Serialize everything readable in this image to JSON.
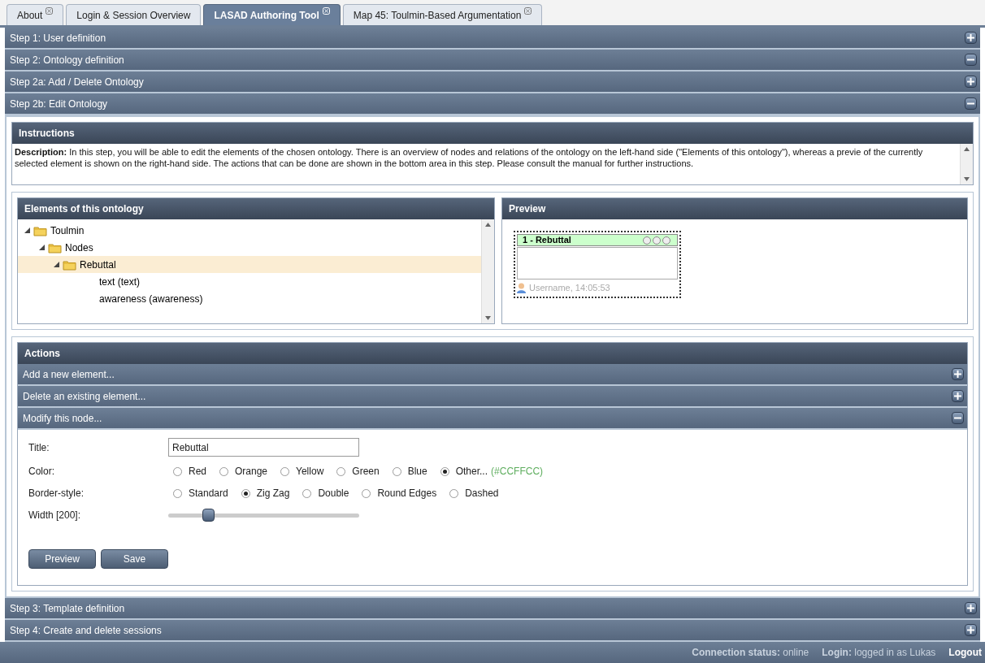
{
  "tabs": [
    {
      "label": "About",
      "selected": false,
      "closable": true
    },
    {
      "label": "Login & Session Overview",
      "selected": false,
      "closable": false
    },
    {
      "label": "LASAD Authoring Tool",
      "selected": true,
      "closable": true
    },
    {
      "label": "Map 45: Toulmin-Based Argumentation",
      "selected": false,
      "closable": true
    }
  ],
  "steps_top": [
    {
      "title": "Step 1: User definition",
      "expanded": false
    },
    {
      "title": "Step 2: Ontology definition",
      "expanded": true
    },
    {
      "title": "Step 2a: Add / Delete Ontology",
      "expanded": false
    },
    {
      "title": "Step 2b: Edit Ontology",
      "expanded": true
    }
  ],
  "instructions": {
    "title": "Instructions",
    "text": "**Description:** In this step, you will be able to edit the elements of the chosen ontology. There is an overview of nodes and relations of the ontology on the left-hand side (\"Elements of this ontology\"), whereas a previe of the currently selected element is shown on the right-hand side. The actions that can be done are shown in the bottom area in this step. Please consult the manual for further instructions."
  },
  "elements": {
    "title": "Elements of this ontology",
    "tree": [
      {
        "label": "Toulmin",
        "folder": true,
        "expanded": true,
        "selected": false,
        "children": [
          {
            "label": "Nodes",
            "folder": true,
            "expanded": true,
            "selected": false,
            "children": [
              {
                "label": "Rebuttal",
                "folder": true,
                "expanded": true,
                "selected": true,
                "children": [
                  {
                    "label": "text (text)",
                    "folder": false,
                    "selected": false
                  },
                  {
                    "label": "awareness (awareness)",
                    "folder": false,
                    "selected": false
                  }
                ]
              }
            ]
          }
        ]
      }
    ]
  },
  "preview": {
    "title": "Preview",
    "node_title": "1 - Rebuttal",
    "footer": "Username, 14:05:53"
  },
  "actions": {
    "title": "Actions",
    "sections": [
      {
        "title": "Add a new element...",
        "expanded": false
      },
      {
        "title": "Delete an existing element...",
        "expanded": false
      },
      {
        "title": "Modify this node...",
        "expanded": true
      }
    ],
    "form": {
      "title_label": "Title:",
      "title_value": "Rebuttal",
      "color_label": "Color:",
      "colors": [
        {
          "label": "Red",
          "selected": false
        },
        {
          "label": "Orange",
          "selected": false
        },
        {
          "label": "Yellow",
          "selected": false
        },
        {
          "label": "Green",
          "selected": false
        },
        {
          "label": "Blue",
          "selected": false
        },
        {
          "label": "Other...",
          "selected": true
        }
      ],
      "other_color": "(#CCFFCC)",
      "border_label": "Border-style:",
      "borders": [
        {
          "label": "Standard",
          "selected": false
        },
        {
          "label": "Zig Zag",
          "selected": true
        },
        {
          "label": "Double",
          "selected": false
        },
        {
          "label": "Round Edges",
          "selected": false
        },
        {
          "label": "Dashed",
          "selected": false
        }
      ],
      "width_label": "Width [200]:",
      "width": {
        "level": 0.21
      }
    },
    "buttons": [
      "Preview",
      "Save"
    ]
  },
  "steps_bottom": [
    {
      "title": "Step 3: Template definition",
      "expanded": false
    },
    {
      "title": "Step 4: Create and delete sessions",
      "expanded": false
    }
  ],
  "status": {
    "connection_label": "Connection status:",
    "connection_value": "online",
    "login_label": "Login:",
    "login_value": "logged in as Lukas",
    "logout": "Logout"
  }
}
